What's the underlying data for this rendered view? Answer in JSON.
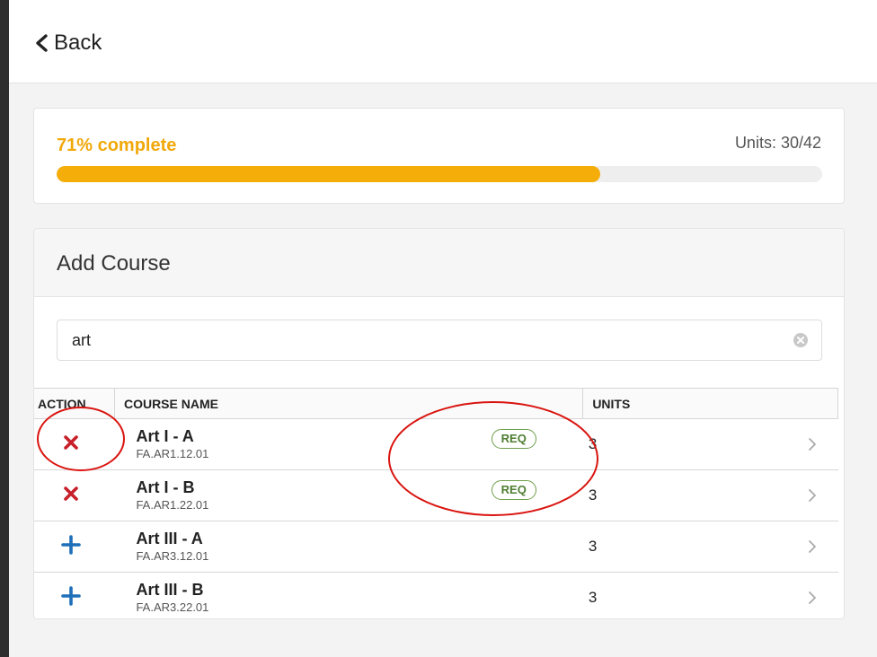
{
  "header": {
    "back_label": "Back"
  },
  "progress": {
    "label": "71% complete",
    "fraction": 0.71,
    "units_label": "Units: 30/42",
    "fill_color": "#f5ad0a",
    "text_color": "#f1a80a"
  },
  "add_course": {
    "title": "Add Course",
    "search": {
      "value": "art"
    },
    "columns": {
      "action": "ACTION",
      "name": "COURSE NAME",
      "units": "UNITS"
    },
    "rows": [
      {
        "action": "remove",
        "title": "Art I - A",
        "code": "FA.AR1.12.01",
        "badge": "REQ",
        "units": "3"
      },
      {
        "action": "remove",
        "title": "Art I - B",
        "code": "FA.AR1.22.01",
        "badge": "REQ",
        "units": "3"
      },
      {
        "action": "add",
        "title": "Art III - A",
        "code": "FA.AR3.12.01",
        "badge": "",
        "units": "3"
      },
      {
        "action": "add",
        "title": "Art III - B",
        "code": "FA.AR3.22.01",
        "badge": "",
        "units": "3"
      }
    ]
  },
  "colors": {
    "remove_icon": "#c8202b",
    "add_icon": "#1f6fb8",
    "req_badge": "#4e7d30",
    "annotation": "#d9140f"
  },
  "icons": {
    "back": "chevron-left-icon",
    "clear": "clear-circle-icon",
    "remove": "x-icon",
    "add": "plus-icon",
    "row": "chevron-right-icon"
  }
}
